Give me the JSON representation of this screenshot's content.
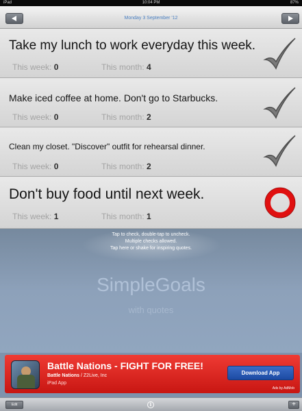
{
  "status": {
    "device": "iPad",
    "time": "10:04 PM",
    "battery": "87%"
  },
  "nav": {
    "date": "Monday 3 September '12"
  },
  "goals": [
    {
      "title": "Take my lunch to work everyday this week.",
      "week_label": "This week:",
      "week_value": "0",
      "month_label": "This month:",
      "month_value": "4",
      "mark": "check-icon"
    },
    {
      "title": "Make iced coffee at home. Don't go to Starbucks.",
      "week_label": "This week:",
      "week_value": "0",
      "month_label": "This month:",
      "month_value": "2",
      "mark": "check-icon"
    },
    {
      "title": "Clean my closet. \"Discover\" outfit for rehearsal dinner.",
      "week_label": "This week:",
      "week_value": "0",
      "month_label": "This month:",
      "month_value": "2",
      "mark": "check-icon"
    },
    {
      "title": "Don't buy food until next week.",
      "week_label": "This week:",
      "week_value": "1",
      "month_label": "This month:",
      "month_value": "1",
      "mark": "circle-icon"
    }
  ],
  "instructions": [
    "Tap to check, double-tap to uncheck.",
    "Multiple checks allowed.",
    "Tap here or shake for inspiring quotes."
  ],
  "brand": {
    "name": "SimpleGoals",
    "tagline": "with quotes"
  },
  "ad": {
    "title": "Battle Nations - FIGHT FOR FREE!",
    "developer_name": "Battle Nations",
    "developer_company": "Z2Live, Inc",
    "platform": "iPad App",
    "button": "Download App",
    "attribution": "Ads by AdMob"
  },
  "toolbar": {
    "edit": "Edit",
    "info": "i",
    "add": "+"
  },
  "colors": {
    "accent": "#4a7fc0",
    "ad_red": "#d9221d",
    "check_gray": "#7a7a7a",
    "circle_red": "#e01010"
  }
}
